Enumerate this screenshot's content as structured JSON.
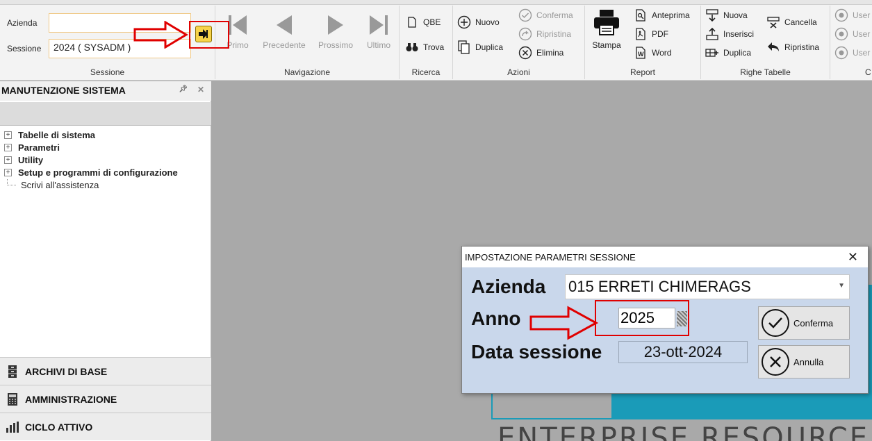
{
  "session": {
    "azienda_label": "Azienda",
    "azienda_value": "",
    "sessione_label": "Sessione",
    "sessione_value": "2024 ( SYSADM )",
    "group_label": "Sessione"
  },
  "navigation": {
    "primo": "Primo",
    "precedente": "Precedente",
    "prossimo": "Prossimo",
    "ultimo": "Ultimo",
    "group_label": "Navigazione"
  },
  "ricerca": {
    "qbe": "QBE",
    "trova": "Trova",
    "group_label": "Ricerca"
  },
  "azioni": {
    "nuovo": "Nuovo",
    "duplica": "Duplica",
    "conferma": "Conferma",
    "ripristina": "Ripristina",
    "elimina": "Elimina",
    "group_label": "Azioni"
  },
  "report": {
    "stampa": "Stampa",
    "anteprima": "Anteprima",
    "pdf": "PDF",
    "word": "Word",
    "group_label": "Report"
  },
  "righe": {
    "nuova": "Nuova",
    "inserisci": "Inserisci",
    "duplica": "Duplica",
    "cancella": "Cancella",
    "ripristina": "Ripristina",
    "group_label": "Righe Tabelle"
  },
  "user_group": {
    "items": [
      "User",
      "User",
      "User"
    ],
    "group_label": "C"
  },
  "left_panel": {
    "title": "MANUTENZIONE SISTEMA",
    "tree": [
      {
        "label": "Tabelle di sistema",
        "bold": true
      },
      {
        "label": "Parametri",
        "bold": true
      },
      {
        "label": "Utility",
        "bold": true
      },
      {
        "label": "Setup e programmi di configurazione",
        "bold": true
      },
      {
        "label": "Scrivi all'assistenza",
        "bold": false
      }
    ],
    "sections": [
      "ARCHIVI DI BASE",
      "AMMINISTRAZIONE",
      "CICLO ATTIVO"
    ]
  },
  "background": {
    "text": "ENTERPRISE RESOURCE"
  },
  "dialog": {
    "title": "IMPOSTAZIONE PARAMETRI SESSIONE",
    "azienda_label": "Azienda",
    "azienda_value": "015 ERRETI CHIMERAGS",
    "anno_label": "Anno",
    "anno_value": "2025",
    "data_label": "Data sessione",
    "data_value": "23-ott-2024",
    "conferma": "Conferma",
    "annulla": "Annulla"
  },
  "colors": {
    "annotation": "#e00000",
    "go_button": "#f7d34a",
    "dialog_bg": "#c9d7eb",
    "teal": "#1a9bb8"
  }
}
